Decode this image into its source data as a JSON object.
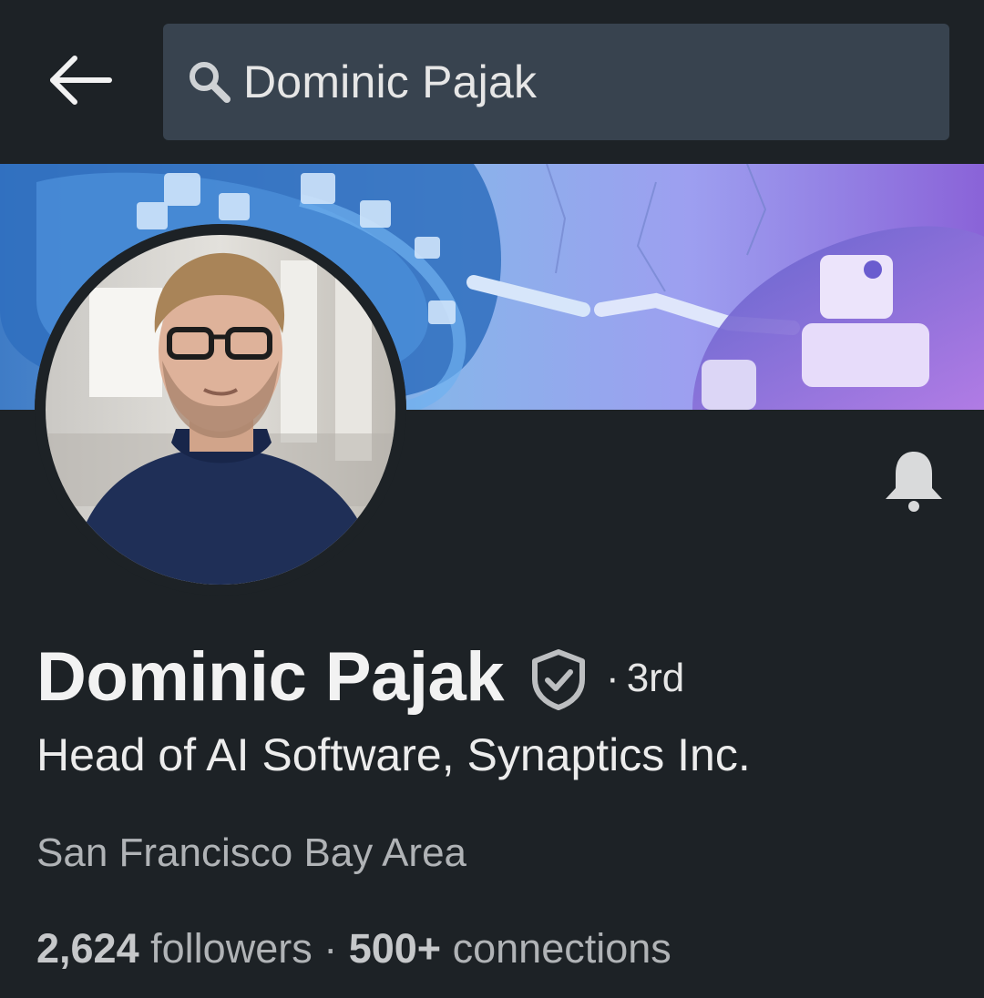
{
  "search": {
    "query": "Dominic Pajak"
  },
  "icons": {
    "back": "arrow-left-icon",
    "search": "search-icon",
    "bell": "bell-icon",
    "verified": "verified-shield-icon"
  },
  "profile": {
    "name": "Dominic Pajak",
    "degree": "3rd",
    "headline": "Head of AI Software, Synaptics Inc.",
    "location": "San Francisco Bay Area",
    "followers_count": "2,624",
    "followers_label": "followers",
    "connections_count": "500+",
    "connections_label": "connections"
  },
  "colors": {
    "background": "#1d2226",
    "search_field": "#38434f",
    "text_primary": "#f2f2f2",
    "text_secondary": "#b0b3b6"
  }
}
